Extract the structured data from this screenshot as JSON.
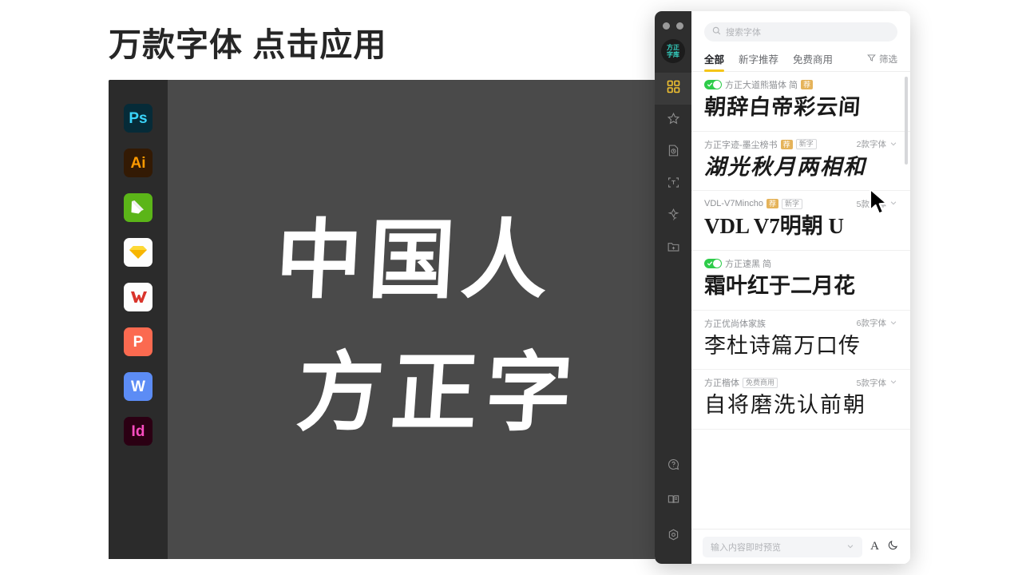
{
  "promo": {
    "headline": "万款字体 点击应用"
  },
  "design_app": {
    "canvas_text_line1": "中国人",
    "canvas_text_line2": "方正字",
    "dock_apps": [
      {
        "name": "photoshop",
        "label": "Ps",
        "bg": "#062b38",
        "fg": "#3ad5fb"
      },
      {
        "name": "illustrator",
        "label": "Ai",
        "bg": "#331a04",
        "fg": "#ff9a00"
      },
      {
        "name": "pencil-app",
        "label": "",
        "bg": "#5bb518",
        "fg": "#ffffff"
      },
      {
        "name": "sketch",
        "label": "",
        "bg": "#fdfdfd",
        "fg": "#f7b500"
      },
      {
        "name": "wps",
        "label": "W",
        "bg": "#fdfdfd",
        "fg": "#d33"
      },
      {
        "name": "presentation",
        "label": "P",
        "bg": "#fb6a50",
        "fg": "#ffffff"
      },
      {
        "name": "word",
        "label": "W",
        "bg": "#5c8cf5",
        "fg": "#ffffff"
      },
      {
        "name": "indesign",
        "label": "Id",
        "bg": "#2b0013",
        "fg": "#fc4dc1"
      }
    ]
  },
  "font_manager": {
    "brand_line1": "方正",
    "brand_line2": "字库",
    "search": {
      "placeholder": "搜索字体",
      "value": ""
    },
    "tabs": [
      {
        "label": "全部",
        "active": true
      },
      {
        "label": "新字推荐",
        "active": false
      },
      {
        "label": "免费商用",
        "active": false
      }
    ],
    "filter_label": "筛选",
    "rail_items": [
      {
        "name": "grid-icon",
        "active": true
      },
      {
        "name": "star-icon",
        "active": false
      },
      {
        "name": "recent-document-icon",
        "active": false
      },
      {
        "name": "text-recognize-icon",
        "active": false
      },
      {
        "name": "ai-flower-icon",
        "active": false
      },
      {
        "name": "add-folder-icon",
        "active": false
      }
    ],
    "rail_bottom_items": [
      {
        "name": "help-icon"
      },
      {
        "name": "manual-book-icon"
      },
      {
        "name": "settings-icon"
      }
    ],
    "fonts": [
      {
        "name": "方正大道熊猫体 简",
        "installed": true,
        "badges": [
          {
            "type": "rec",
            "label": "荐"
          }
        ],
        "count": "",
        "sample": "朝辞白帝彩云间",
        "style": "s-panda"
      },
      {
        "name": "方正字迹-墨尘榜书",
        "installed": false,
        "badges": [
          {
            "type": "rec",
            "label": "荐"
          },
          {
            "type": "new",
            "label": "新字"
          }
        ],
        "count": "2款字体",
        "sample": "湖光秋月两相和",
        "style": "s-brush"
      },
      {
        "name": "VDL-V7Mincho",
        "installed": false,
        "badges": [
          {
            "type": "rec",
            "label": "荐"
          },
          {
            "type": "new",
            "label": "新字"
          }
        ],
        "count": "5款字体",
        "sample": "VDL V7明朝 U",
        "style": "s-mincho"
      },
      {
        "name": "方正速黑 简",
        "installed": true,
        "badges": [],
        "count": "",
        "sample": "霜叶红于二月花",
        "style": "s-gothic"
      },
      {
        "name": "方正优尚体家族",
        "installed": false,
        "badges": [],
        "count": "6款字体",
        "sample": "李杜诗篇万口传",
        "style": "s-round"
      },
      {
        "name": "方正楷体",
        "installed": false,
        "badges": [
          {
            "type": "free",
            "label": "免费商用"
          }
        ],
        "count": "5款字体",
        "sample": "自将磨洗认前朝",
        "style": "s-kai"
      }
    ],
    "footer": {
      "preview_placeholder": "输入内容即时预览",
      "size_icon_label": "A",
      "theme_icon": "moon-icon"
    }
  },
  "colors": {
    "accent_yellow": "#f5c518",
    "toggle_green": "#2ecc4a",
    "badge_orange": "#e5b35a",
    "brand_teal": "#35d6c6"
  }
}
